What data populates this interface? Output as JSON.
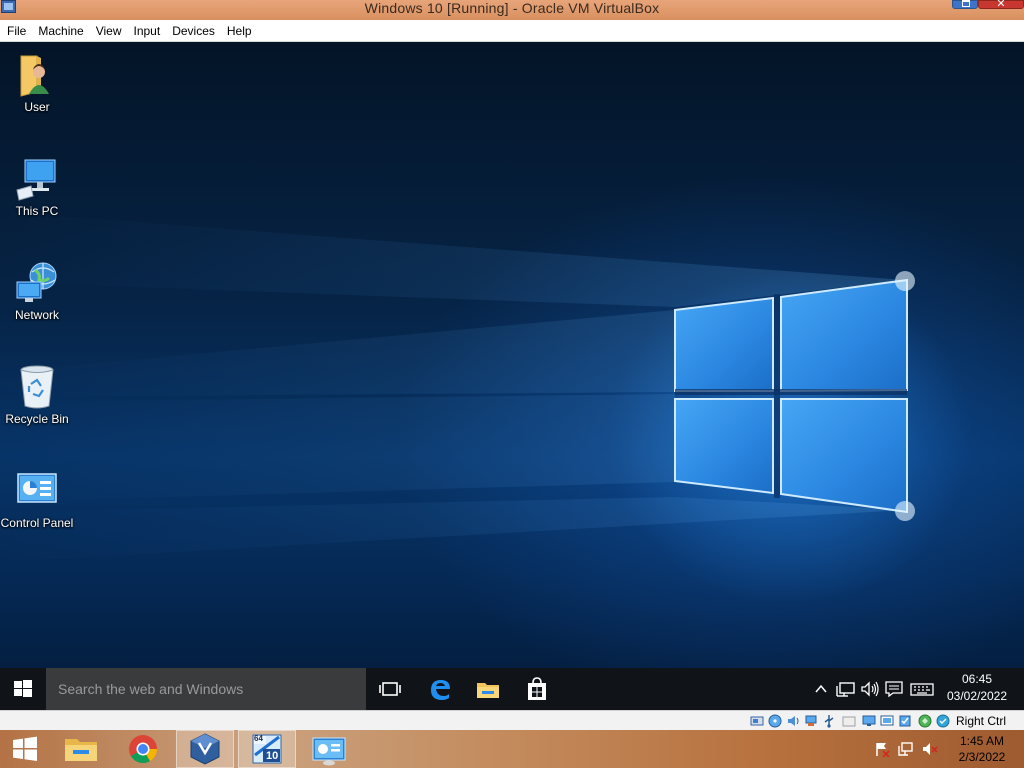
{
  "window": {
    "title": "Windows 10  [Running] - Oracle VM VirtualBox",
    "close_glyph": "✕"
  },
  "menubar": {
    "items": [
      "File",
      "Machine",
      "View",
      "Input",
      "Devices",
      "Help"
    ]
  },
  "desktop": {
    "icons": [
      {
        "label": "User",
        "icon": "user-folder-icon"
      },
      {
        "label": "This PC",
        "icon": "computer-icon"
      },
      {
        "label": "Network",
        "icon": "network-icon"
      },
      {
        "label": "Recycle Bin",
        "icon": "recycle-bin-icon"
      },
      {
        "label": "Control Panel",
        "icon": "control-panel-icon"
      }
    ]
  },
  "guest_taskbar": {
    "search_placeholder": "Search the web and Windows",
    "pinned": [
      "task-view-icon",
      "edge-icon",
      "file-explorer-icon",
      "store-icon"
    ],
    "tray": [
      "chevron-up-icon",
      "network-icon",
      "volume-icon",
      "action-center-icon",
      "keyboard-icon"
    ],
    "time": "06:45",
    "date": "03/02/2022"
  },
  "vbox_statusbar": {
    "indicators": [
      "hard-disk-icon",
      "optical-drive-icon",
      "audio-icon",
      "network-adapter-icon",
      "usb-icon",
      "shared-folders-icon",
      "display-icon",
      "recording-icon",
      "cpu-icon",
      "mouse-integration-icon",
      "keyboard-capture-icon"
    ],
    "host_key_label": "Right Ctrl"
  },
  "host_taskbar": {
    "apps": [
      "start-icon",
      "file-explorer-icon",
      "chrome-icon",
      "virtualbox-icon",
      "windows10-vm-icon",
      "control-panel-icon"
    ],
    "vm_badge_top": "64",
    "vm_badge_bottom": "10",
    "time": "1:45 AM",
    "date": "2/3/2022"
  },
  "colors": {
    "host_accent": "#d8905f",
    "guest_taskbar": "#101318",
    "win10_blue": "#1e90ff"
  }
}
